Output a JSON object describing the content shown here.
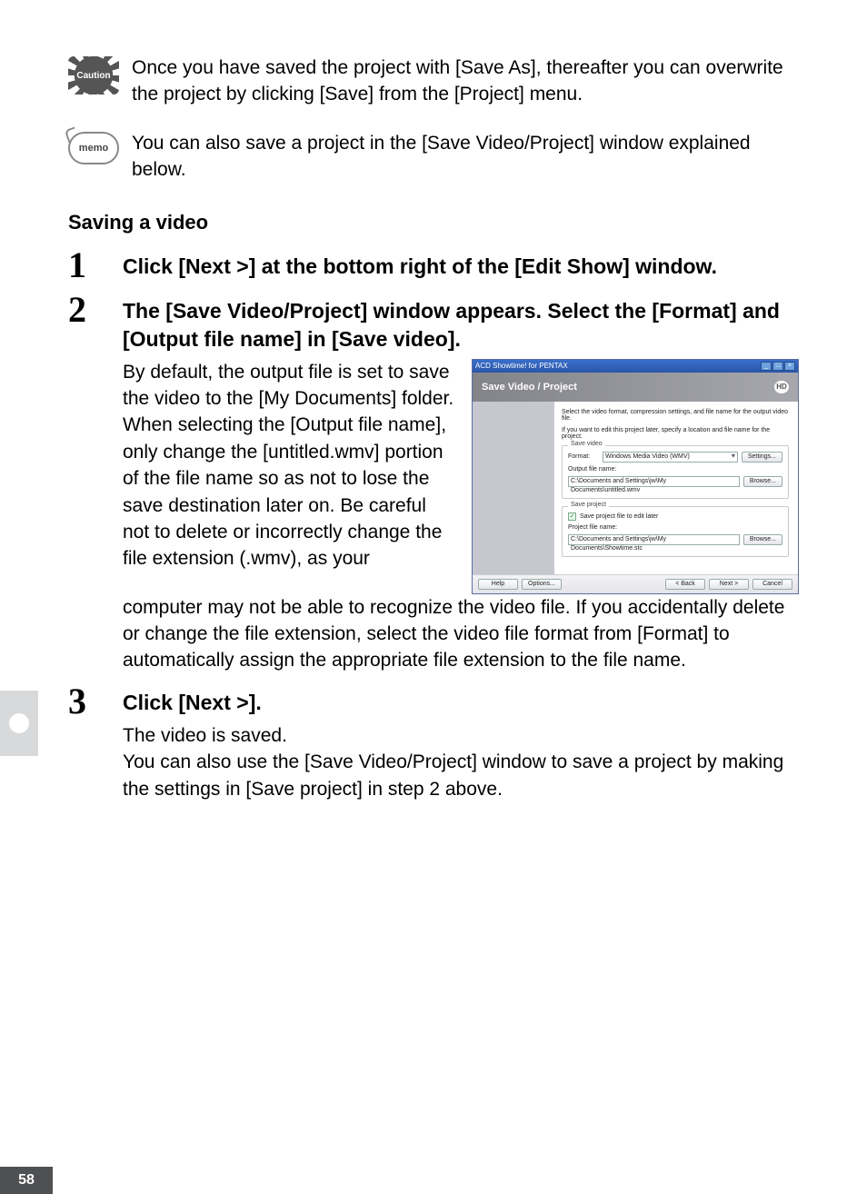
{
  "caution": {
    "icon_label": "Caution",
    "text": "Once you have saved the project with [Save As], thereafter you can overwrite the project by clicking [Save] from the [Project] menu."
  },
  "memo": {
    "icon_label": "memo",
    "text": "You can also save a project in the [Save Video/Project] window explained below."
  },
  "section_heading": "Saving a video",
  "step1": {
    "num": "1",
    "heading": "Click [Next >] at the bottom right of the [Edit Show] window."
  },
  "step2": {
    "num": "2",
    "heading": "The [Save Video/Project] window appears. Select the [Format] and [Output file name] in [Save video].",
    "text_col": "By default, the output file is set to save the video to the [My Documents] folder. When selecting the [Output file name], only change the [untitled.wmv] portion of the file name so as not to lose the save destination later on. Be careful not to delete or incorrectly change the file extension (.wmv), as your",
    "text_after": "computer may not be able to recognize the video file. If you accidentally delete or change the file extension, select the video file format from [Format] to automatically assign the appropriate file extension to the file name."
  },
  "step3": {
    "num": "3",
    "heading": "Click [Next >].",
    "text": "The video is saved.\nYou can also use the [Save Video/Project] window to save a project by making the settings in [Save project] in step 2 above."
  },
  "dialog": {
    "titlebar": "ACD Showtime! for PENTAX",
    "header": "Save Video / Project",
    "header_logo": "HD",
    "desc1": "Select the video format, compression settings, and file name for the output video file.",
    "desc2": "If you want to edit this project later, specify a location and file name for the project.",
    "group_video": {
      "legend": "Save video",
      "format_label": "Format:",
      "format_value": "Windows Media Video (WMV)",
      "settings_btn": "Settings...",
      "output_label": "Output file name:",
      "output_value": "C:\\Documents and Settings\\jw\\My Documents\\untitled.wmv",
      "browse_btn": "Browse..."
    },
    "group_project": {
      "legend": "Save project",
      "checkbox_label": "Save project file to edit later",
      "project_label": "Project file name:",
      "project_value": "C:\\Documents and Settings\\jw\\My Documents\\Showtime.stc",
      "browse_btn": "Browse..."
    },
    "footer": {
      "help": "Help",
      "options": "Options...",
      "back": "< Back",
      "next": "Next >",
      "cancel": "Cancel"
    }
  },
  "page_number": "58"
}
